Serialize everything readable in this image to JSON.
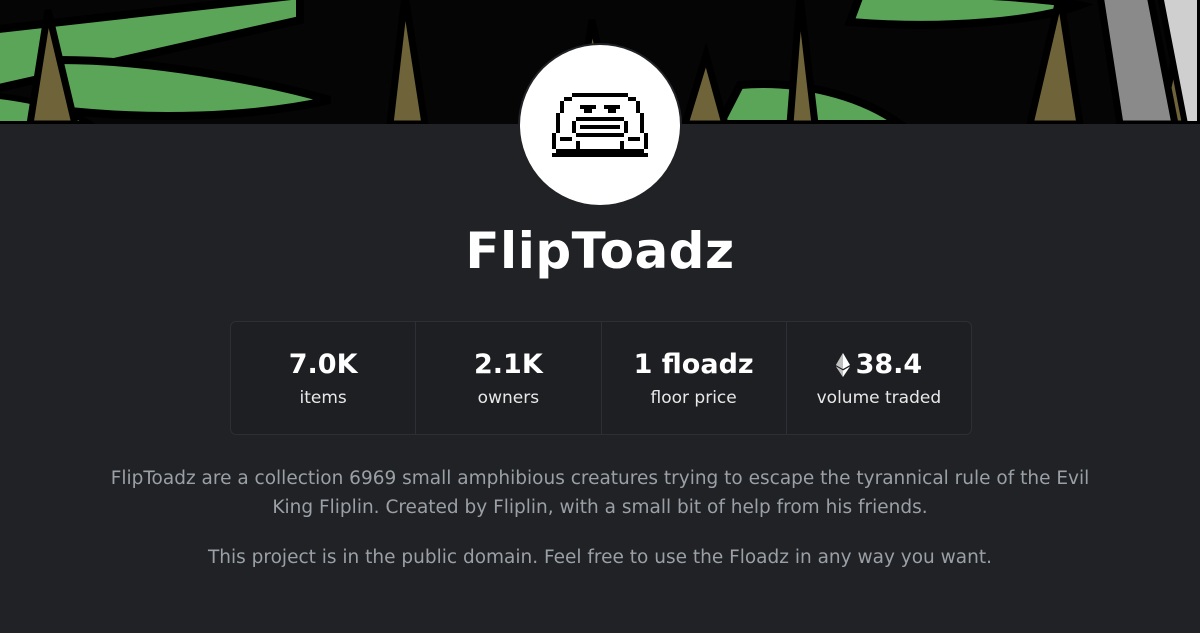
{
  "collection": {
    "name": "FlipToadz",
    "stats": [
      {
        "value": "7.0K",
        "label": "items",
        "icon": null
      },
      {
        "value": "2.1K",
        "label": "owners",
        "icon": null
      },
      {
        "value": "1 floadz",
        "label": "floor price",
        "icon": null
      },
      {
        "value": "38.4",
        "label": "volume traded",
        "icon": "ethereum-icon"
      }
    ],
    "description": [
      "FlipToadz are a collection 6969 small amphibious creatures trying to escape the tyrannical rule of the Evil King Fliplin. Created by Fliplin, with a small bit of help from his friends.",
      "This project is in the public domain. Feel free to use the Floadz in any way you want."
    ]
  },
  "colors": {
    "background": "#202225",
    "banner_green": "#5aa558",
    "banner_brown": "#6f6339",
    "banner_gray": "#8a8a8a",
    "text_muted": "#9aa0a6"
  }
}
